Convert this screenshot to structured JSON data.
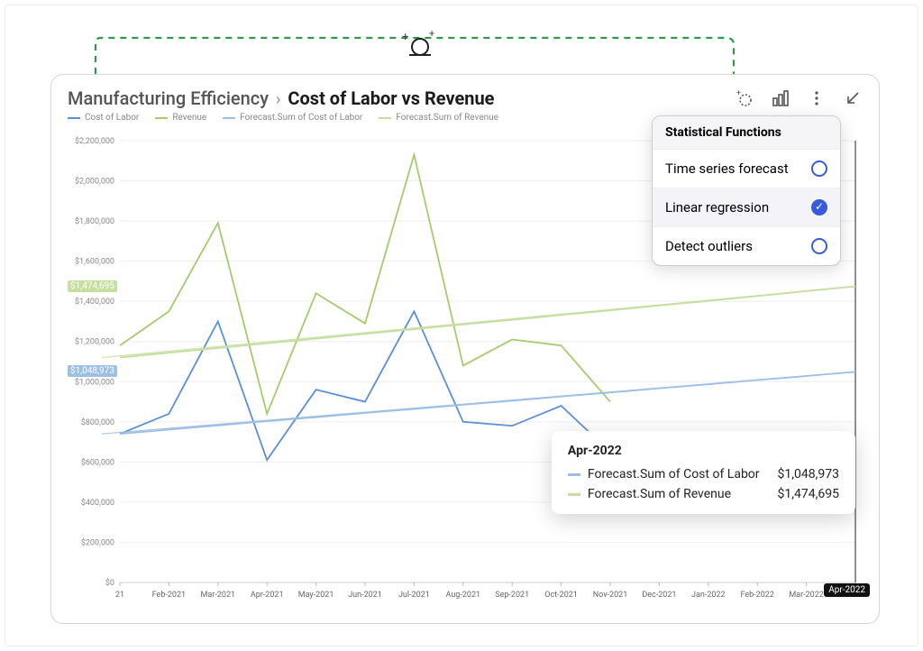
{
  "breadcrumb": {
    "root": "Manufacturing Efficiency",
    "leaf": "Cost of Labor vs Revenue"
  },
  "toolbar_icons": [
    "forecast-icon",
    "bar-chart-icon",
    "more-icon",
    "collapse-icon"
  ],
  "legend": [
    {
      "label": "Cost of Labor",
      "color": "#5b8fd6"
    },
    {
      "label": "Revenue",
      "color": "#a4cc6b"
    },
    {
      "label": "Forecast.Sum of Cost of Labor",
      "color": "#9dbfe6"
    },
    {
      "label": "Forecast.Sum of Revenue",
      "color": "#c6dfa0"
    }
  ],
  "stat_panel": {
    "title": "Statistical Functions",
    "items": [
      {
        "label": "Time series forecast",
        "selected": false
      },
      {
        "label": "Linear regression",
        "selected": true
      },
      {
        "label": "Detect outliers",
        "selected": false
      }
    ]
  },
  "forecast_labels": {
    "cost": {
      "text": "$1,048,973",
      "color": "#9dbfe6"
    },
    "revenue": {
      "text": "$1,474,695",
      "color": "#c6dfa0"
    }
  },
  "hover": {
    "month": "Apr-2022",
    "rows": [
      {
        "label": "Forecast.Sum of Cost of Labor",
        "value": "$1,048,973",
        "color": "#9dbfe6"
      },
      {
        "label": "Forecast.Sum of Revenue",
        "value": "$1,474,695",
        "color": "#c6dfa0"
      }
    ]
  },
  "x_end_label": "Apr-2022",
  "chart_data": {
    "type": "line",
    "title": "Cost of Labor vs Revenue",
    "xlabel": "",
    "ylabel": "",
    "ylim": [
      0,
      2200000
    ],
    "y_ticks": [
      "$0",
      "$200,000",
      "$400,000",
      "$600,000",
      "$800,000",
      "$1,000,000",
      "$1,200,000",
      "$1,400,000",
      "$1,600,000",
      "$1,800,000",
      "$2,000,000",
      "$2,200,000"
    ],
    "categories": [
      "21",
      "Feb-2021",
      "Mar-2021",
      "Apr-2021",
      "May-2021",
      "Jun-2021",
      "Jul-2021",
      "Aug-2021",
      "Sep-2021",
      "Oct-2021",
      "Nov-2021",
      "Dec-2021",
      "Jan-2022",
      "Feb-2022",
      "Mar-2022",
      "Apr-2022"
    ],
    "series": [
      {
        "name": "Cost of Labor",
        "color": "#5b8fd6",
        "values": [
          740000,
          840000,
          1300000,
          610000,
          960000,
          900000,
          1350000,
          800000,
          780000,
          880000,
          650000,
          null,
          null,
          null,
          null,
          null
        ]
      },
      {
        "name": "Revenue",
        "color": "#a4cc6b",
        "values": [
          1180000,
          1350000,
          1790000,
          840000,
          1440000,
          1290000,
          2130000,
          1080000,
          1210000,
          1180000,
          900000,
          null,
          null,
          null,
          null,
          null
        ]
      },
      {
        "name": "Forecast.Sum of Cost of Labor",
        "color": "#9dbfe6",
        "values": [
          740000,
          761000,
          782000,
          803000,
          823000,
          844000,
          864000,
          885000,
          905000,
          926000,
          946000,
          967000,
          987000,
          1008000,
          1028000,
          1048973
        ]
      },
      {
        "name": "Forecast.Sum of Revenue",
        "color": "#c6dfa0",
        "values": [
          1120000,
          1144000,
          1167000,
          1191000,
          1214000,
          1238000,
          1261000,
          1285000,
          1308000,
          1332000,
          1355000,
          1379000,
          1402000,
          1426000,
          1451000,
          1474695
        ]
      }
    ]
  }
}
